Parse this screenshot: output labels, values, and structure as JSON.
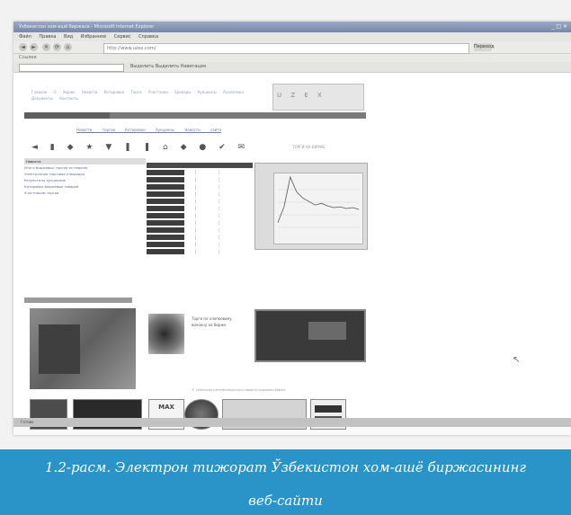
{
  "window": {
    "title": "Ўзбекистон хом-ашё биржаси - Microsoft Internet Explorer",
    "controls": "_ □ ×"
  },
  "menubar": {
    "items": [
      "Файл",
      "Правка",
      "Вид",
      "Избранное",
      "Сервис",
      "Справка"
    ]
  },
  "toolbar": {
    "nav_buttons": [
      "◄",
      "►",
      "✕",
      "⟳",
      "⌂"
    ],
    "address_value": "http://www.uzex.com/",
    "go_label": "Переход",
    "links_label": "Ссылки",
    "toolbar2_text": "Выделить  Выделить  Навигация"
  },
  "site": {
    "nav_text": "Главная О бирже Новости Котировки Торги Участники Брокеры Аукционы Аналитика Документы Контакты",
    "logo_cells": "U Z E X",
    "links_row": "Новости торгов Котировки Аукционы Новости сайта",
    "icons": [
      "◄",
      "▮",
      "◆",
      "★",
      "▼",
      "❚",
      "❚",
      "⌂",
      "◆",
      "●",
      "✔",
      "✉"
    ],
    "ticker": "ТОРГИ НА БИРЖЕ",
    "left_col": {
      "head": "Новости",
      "lines": [
        "Итоги биржевых торгов за неделю",
        "Электронная торговая площадка",
        "Результаты аукционов",
        "Котировки биржевых товаров",
        "Участникам торгов"
      ]
    },
    "img_b_text": "Торги по хлопковому волокну на бирже",
    "footer_note": "© Узбекская республиканская товарно-сырьевая биржа",
    "b3_label": "МАХ"
  },
  "statusbar": {
    "text": "Готово"
  },
  "caption": {
    "line1": "1.2-расм. Электрон тижорат  Ўзбекистон хом-ашё биржасининг",
    "line2": "веб-сайти"
  },
  "chart_data": {
    "type": "line",
    "title": "",
    "series": [
      {
        "values": [
          20,
          38,
          72,
          55,
          48,
          44,
          40,
          42,
          39,
          37,
          38,
          36,
          37,
          35
        ]
      }
    ]
  }
}
